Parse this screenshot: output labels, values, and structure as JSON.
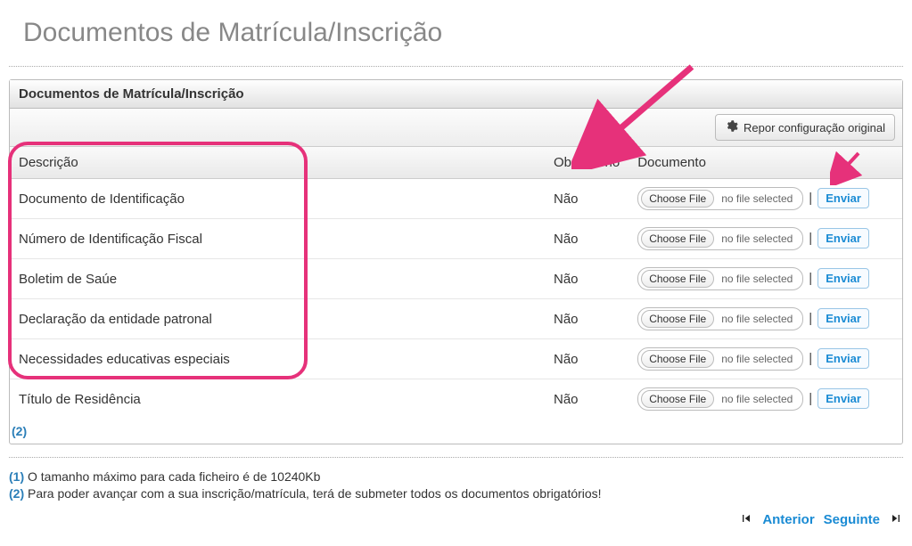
{
  "page": {
    "title": "Documentos de Matrícula/Inscrição"
  },
  "panel": {
    "header": "Documentos de Matrícula/Inscrição",
    "reset_label": "Repor configuração original"
  },
  "table": {
    "headers": {
      "description": "Descrição",
      "mandatory": "Obrigatório",
      "document": "Documento"
    },
    "choose_label": "Choose File",
    "nofile_label": "no file selected",
    "send_label": "Enviar",
    "rows": [
      {
        "desc": "Documento de Identificação",
        "mandatory": "Não"
      },
      {
        "desc": "Número de Identificação Fiscal",
        "mandatory": "Não"
      },
      {
        "desc": "Boletim de Saúe",
        "mandatory": "Não"
      },
      {
        "desc": "Declaração da entidade patronal",
        "mandatory": "Não"
      },
      {
        "desc": "Necessidades educativas especiais",
        "mandatory": "Não"
      },
      {
        "desc": "Título de Residência",
        "mandatory": "Não"
      }
    ],
    "footnote_ref": "(2)"
  },
  "notes": {
    "n1_num": "(1)",
    "n1_text": " O tamanho máximo para cada ficheiro é de 10240Kb",
    "n2_num": "(2)",
    "n2_text": " Para poder avançar com a sua inscrição/matrícula, terá de submeter todos os documentos obrigatórios!"
  },
  "nav": {
    "prev": "Anterior",
    "next": "Seguinte"
  }
}
